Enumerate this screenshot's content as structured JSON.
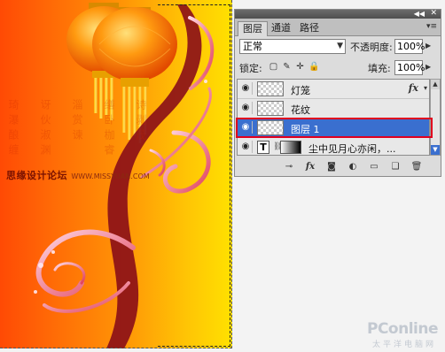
{
  "canvas": {
    "watermark_text": "思缘设计论坛",
    "watermark_url": "WWW.MISSYUAN.COM",
    "vertical_columns": [
      "琦瀑酿缠",
      "讶伙淑渊",
      "淄赏谏",
      "缮卧枷睿",
      "诗剥茂"
    ]
  },
  "panel": {
    "tabs": [
      {
        "label": "图层",
        "active": true
      },
      {
        "label": "通道",
        "active": false
      },
      {
        "label": "路径",
        "active": false
      }
    ],
    "blend_mode": "正常",
    "opacity_label": "不透明度:",
    "opacity_value": "100%",
    "lock_label": "锁定:",
    "fill_label": "填充:",
    "fill_value": "100%",
    "layers": [
      {
        "name": "灯笼",
        "fx": "fx",
        "selected": false
      },
      {
        "name": "花纹",
        "selected": false
      },
      {
        "name": "图层 1",
        "selected": true
      },
      {
        "name": "尘中见月心亦闲，...",
        "type_layer": "T",
        "selected": false
      }
    ],
    "bottom_icons": [
      "link-icon",
      "fx-icon",
      "mask-icon",
      "adjustment-icon",
      "group-icon",
      "new-layer-icon",
      "trash-icon"
    ],
    "fx_symbol": "fx"
  },
  "brand": {
    "name": "PConline",
    "tagline": "太平洋电脑网"
  },
  "colors": {
    "selected_row": "#3a6fcf",
    "highlight_box": "#e0001e",
    "canvas_left": "#ff4a05",
    "canvas_right": "#ffe100"
  }
}
